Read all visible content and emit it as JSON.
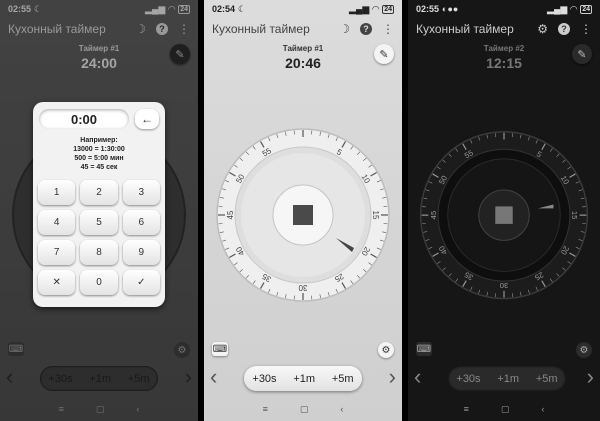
{
  "app_title": "Кухонный таймер",
  "screens": [
    {
      "status": {
        "time": "02:55",
        "battery": "24"
      },
      "timer_name": "Таймер #1",
      "timer_time": "24:00",
      "keypad": {
        "display": "0:00",
        "hint_lines": [
          "Например:",
          "13000 = 1:30:00",
          "500 = 5:00 мин",
          "45 = 45 сек"
        ],
        "keys": [
          "1",
          "2",
          "3",
          "4",
          "5",
          "6",
          "7",
          "8",
          "9",
          "✕",
          "0",
          "✓"
        ]
      }
    },
    {
      "status": {
        "time": "02:54",
        "battery": "24"
      },
      "timer_name": "Таймер #1",
      "timer_time": "20:46",
      "dial_labels": [
        "5",
        "10",
        "15",
        "20",
        "25",
        "30",
        "35",
        "40",
        "45",
        "50",
        "55"
      ]
    },
    {
      "status": {
        "time": "02:55",
        "battery": "24"
      },
      "timer_name": "Таймер #2",
      "timer_time": "12:15",
      "dial_labels": [
        "5",
        "10",
        "15",
        "20",
        "25",
        "30",
        "35",
        "40",
        "45",
        "50",
        "55"
      ]
    }
  ],
  "quick_buttons": [
    "+30s",
    "+1m",
    "+5m"
  ],
  "icons": {
    "moon": "☽",
    "help": "?",
    "menu": "⋮",
    "edit": "✎",
    "keyboard": "⌨",
    "settings": "⚙",
    "prev": "‹",
    "next": "›",
    "back": "←",
    "sys_menu": "≡",
    "sys_home": "▢",
    "sys_back": "‹"
  }
}
